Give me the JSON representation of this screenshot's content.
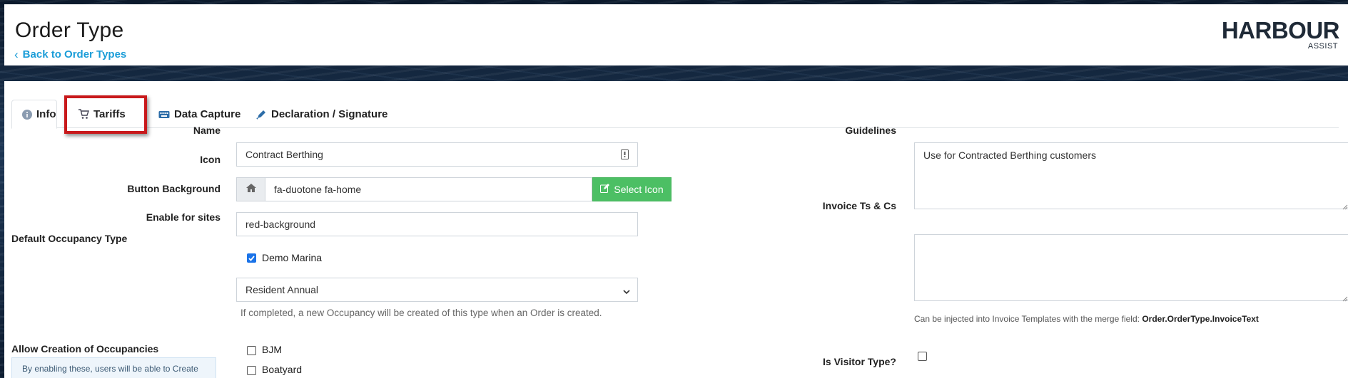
{
  "header": {
    "title": "Order Type",
    "back_label": "Back to Order Types",
    "logo_main": "HARBOUR",
    "logo_sub": "ASSIST"
  },
  "tabs": [
    {
      "label": "Info",
      "icon": "info-circle-icon",
      "active": true
    },
    {
      "label": "Tariffs",
      "icon": "cart-icon",
      "active": false,
      "highlighted": true
    },
    {
      "label": "Data Capture",
      "icon": "keyboard-icon",
      "active": false
    },
    {
      "label": "Declaration / Signature",
      "icon": "pen-icon",
      "active": false
    }
  ],
  "form": {
    "name": {
      "label": "Name",
      "value": "Contract Berthing"
    },
    "icon": {
      "label": "Icon",
      "value": "fa-duotone fa-home",
      "button": "Select Icon"
    },
    "button_background": {
      "label": "Button Background",
      "value": "red-background"
    },
    "enable_for_sites": {
      "label": "Enable for sites",
      "options": [
        {
          "label": "Demo Marina",
          "checked": true
        }
      ]
    },
    "default_occupancy": {
      "label": "Default Occupancy Type",
      "value": "Resident Annual",
      "help": "If completed, a new Occupancy will be created of this type when an Order is created."
    },
    "allow_creation": {
      "label": "Allow Creation of Occupancies",
      "info": "By enabling these, users will be able to Create",
      "options": [
        {
          "label": "BJM",
          "checked": false
        },
        {
          "label": "Boatyard",
          "checked": false
        }
      ]
    },
    "guidelines": {
      "label": "Guidelines",
      "value": "Use for Contracted Berthing customers"
    },
    "invoice_tcs": {
      "label": "Invoice Ts & Cs",
      "value": "",
      "help_prefix": "Can be injected into Invoice Templates with the merge field:",
      "help_field": "Order.OrderType.InvoiceText"
    },
    "is_visitor": {
      "label": "Is Visitor Type?",
      "checked": false
    }
  },
  "colors": {
    "accent_link": "#1b9dd8",
    "green_button": "#4cbf64",
    "highlight_red": "#c8191b",
    "checkbox_blue": "#1a73e8"
  }
}
